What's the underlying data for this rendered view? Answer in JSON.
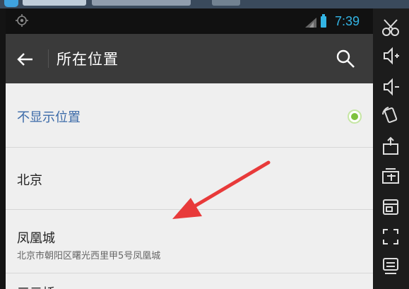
{
  "statusbar": {
    "time": "7:39"
  },
  "actionbar": {
    "title": "所在位置"
  },
  "locations": [
    {
      "name": "不显示位置",
      "address": "",
      "selected": true
    },
    {
      "name": "北京",
      "address": ""
    },
    {
      "name": "凤凰城",
      "address": "北京市朝阳区曙光西里甲5号凤凰城"
    },
    {
      "name": "三元桥",
      "address": ""
    }
  ],
  "toolbar": {
    "icons": [
      "scissors-icon",
      "volume-up-icon",
      "volume-down-icon",
      "rotate-icon",
      "apk-install-icon",
      "shared-folder-icon",
      "window-icon",
      "fullscreen-icon",
      "keyboard-icon"
    ]
  },
  "colors": {
    "accent": "#33b5e5",
    "selected_text": "#3b6aa8",
    "radio": "#7ec23d",
    "arrow": "#e83a3a"
  }
}
